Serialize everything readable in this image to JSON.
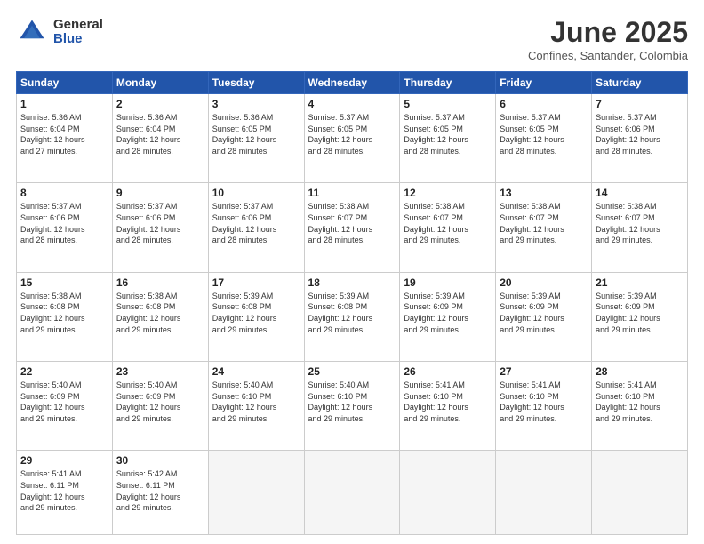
{
  "header": {
    "logo_general": "General",
    "logo_blue": "Blue",
    "month_title": "June 2025",
    "subtitle": "Confines, Santander, Colombia"
  },
  "days_of_week": [
    "Sunday",
    "Monday",
    "Tuesday",
    "Wednesday",
    "Thursday",
    "Friday",
    "Saturday"
  ],
  "weeks": [
    [
      {
        "day": "1",
        "sunrise": "5:36 AM",
        "sunset": "6:04 PM",
        "daylight": "12 hours and 27 minutes."
      },
      {
        "day": "2",
        "sunrise": "5:36 AM",
        "sunset": "6:04 PM",
        "daylight": "12 hours and 28 minutes."
      },
      {
        "day": "3",
        "sunrise": "5:36 AM",
        "sunset": "6:05 PM",
        "daylight": "12 hours and 28 minutes."
      },
      {
        "day": "4",
        "sunrise": "5:37 AM",
        "sunset": "6:05 PM",
        "daylight": "12 hours and 28 minutes."
      },
      {
        "day": "5",
        "sunrise": "5:37 AM",
        "sunset": "6:05 PM",
        "daylight": "12 hours and 28 minutes."
      },
      {
        "day": "6",
        "sunrise": "5:37 AM",
        "sunset": "6:05 PM",
        "daylight": "12 hours and 28 minutes."
      },
      {
        "day": "7",
        "sunrise": "5:37 AM",
        "sunset": "6:06 PM",
        "daylight": "12 hours and 28 minutes."
      }
    ],
    [
      {
        "day": "8",
        "sunrise": "5:37 AM",
        "sunset": "6:06 PM",
        "daylight": "12 hours and 28 minutes."
      },
      {
        "day": "9",
        "sunrise": "5:37 AM",
        "sunset": "6:06 PM",
        "daylight": "12 hours and 28 minutes."
      },
      {
        "day": "10",
        "sunrise": "5:37 AM",
        "sunset": "6:06 PM",
        "daylight": "12 hours and 28 minutes."
      },
      {
        "day": "11",
        "sunrise": "5:38 AM",
        "sunset": "6:07 PM",
        "daylight": "12 hours and 28 minutes."
      },
      {
        "day": "12",
        "sunrise": "5:38 AM",
        "sunset": "6:07 PM",
        "daylight": "12 hours and 29 minutes."
      },
      {
        "day": "13",
        "sunrise": "5:38 AM",
        "sunset": "6:07 PM",
        "daylight": "12 hours and 29 minutes."
      },
      {
        "day": "14",
        "sunrise": "5:38 AM",
        "sunset": "6:07 PM",
        "daylight": "12 hours and 29 minutes."
      }
    ],
    [
      {
        "day": "15",
        "sunrise": "5:38 AM",
        "sunset": "6:08 PM",
        "daylight": "12 hours and 29 minutes."
      },
      {
        "day": "16",
        "sunrise": "5:38 AM",
        "sunset": "6:08 PM",
        "daylight": "12 hours and 29 minutes."
      },
      {
        "day": "17",
        "sunrise": "5:39 AM",
        "sunset": "6:08 PM",
        "daylight": "12 hours and 29 minutes."
      },
      {
        "day": "18",
        "sunrise": "5:39 AM",
        "sunset": "6:08 PM",
        "daylight": "12 hours and 29 minutes."
      },
      {
        "day": "19",
        "sunrise": "5:39 AM",
        "sunset": "6:09 PM",
        "daylight": "12 hours and 29 minutes."
      },
      {
        "day": "20",
        "sunrise": "5:39 AM",
        "sunset": "6:09 PM",
        "daylight": "12 hours and 29 minutes."
      },
      {
        "day": "21",
        "sunrise": "5:39 AM",
        "sunset": "6:09 PM",
        "daylight": "12 hours and 29 minutes."
      }
    ],
    [
      {
        "day": "22",
        "sunrise": "5:40 AM",
        "sunset": "6:09 PM",
        "daylight": "12 hours and 29 minutes."
      },
      {
        "day": "23",
        "sunrise": "5:40 AM",
        "sunset": "6:09 PM",
        "daylight": "12 hours and 29 minutes."
      },
      {
        "day": "24",
        "sunrise": "5:40 AM",
        "sunset": "6:10 PM",
        "daylight": "12 hours and 29 minutes."
      },
      {
        "day": "25",
        "sunrise": "5:40 AM",
        "sunset": "6:10 PM",
        "daylight": "12 hours and 29 minutes."
      },
      {
        "day": "26",
        "sunrise": "5:41 AM",
        "sunset": "6:10 PM",
        "daylight": "12 hours and 29 minutes."
      },
      {
        "day": "27",
        "sunrise": "5:41 AM",
        "sunset": "6:10 PM",
        "daylight": "12 hours and 29 minutes."
      },
      {
        "day": "28",
        "sunrise": "5:41 AM",
        "sunset": "6:10 PM",
        "daylight": "12 hours and 29 minutes."
      }
    ],
    [
      {
        "day": "29",
        "sunrise": "5:41 AM",
        "sunset": "6:11 PM",
        "daylight": "12 hours and 29 minutes."
      },
      {
        "day": "30",
        "sunrise": "5:42 AM",
        "sunset": "6:11 PM",
        "daylight": "12 hours and 29 minutes."
      },
      null,
      null,
      null,
      null,
      null
    ]
  ],
  "labels": {
    "sunrise": "Sunrise:",
    "sunset": "Sunset:",
    "daylight": "Daylight:"
  }
}
